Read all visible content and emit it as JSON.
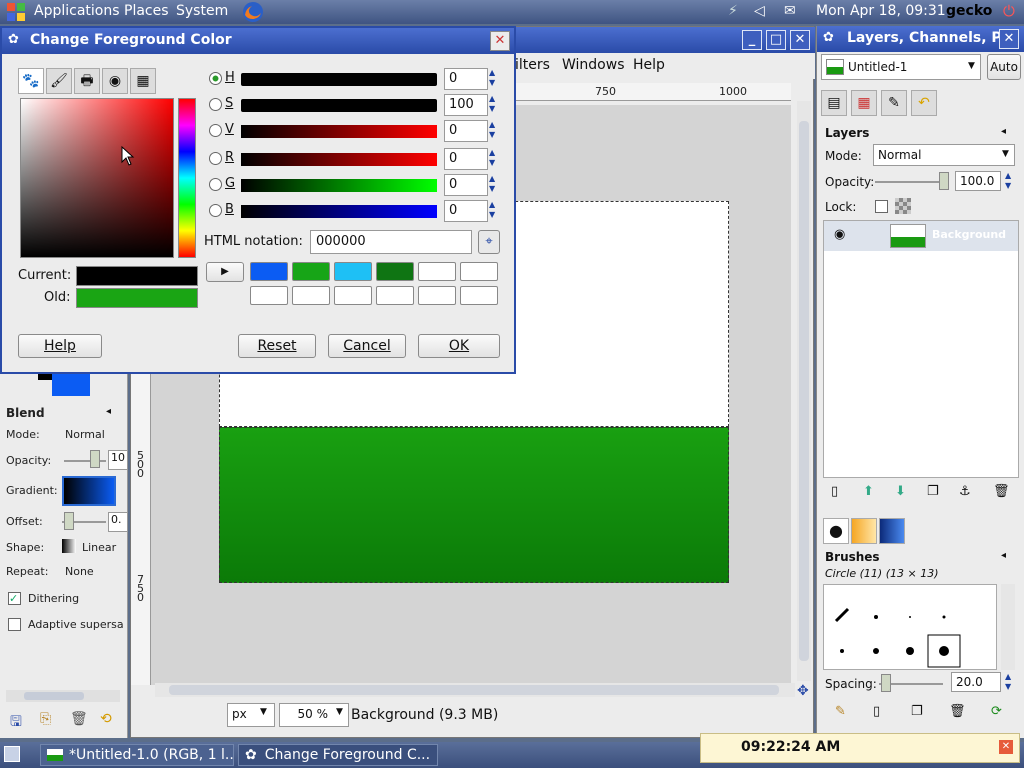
{
  "top_panel": {
    "menu": [
      "Applications",
      "Places",
      "System"
    ],
    "datetime": "Mon Apr 18, 09:31",
    "user": "gecko"
  },
  "taskbar": {
    "tasks": [
      "*Untitled-1.0 (RGB, 1 l...",
      "Change Foreground C..."
    ],
    "clock_popup": "09:22:24 AM"
  },
  "image_window": {
    "menus": [
      "ilters",
      "Windows",
      "Help"
    ],
    "ruler_ticks": [
      "750",
      "1000"
    ],
    "vruler_ticks": [
      "5\n0\n0",
      "7\n5\n0"
    ],
    "units": "px",
    "zoom": "50 %",
    "status": "Background (9.3 MB)",
    "canvas": {
      "top_color": "#ffffff",
      "bottom_color": "#119b0e"
    }
  },
  "dialog": {
    "title": "Change Foreground Color",
    "sliders": [
      {
        "label": "H",
        "value": "0"
      },
      {
        "label": "S",
        "value": "100"
      },
      {
        "label": "V",
        "value": "0"
      },
      {
        "label": "R",
        "value": "0"
      },
      {
        "label": "G",
        "value": "0"
      },
      {
        "label": "B",
        "value": "0"
      }
    ],
    "html_notation_label": "HTML notation:",
    "html_notation_value": "000000",
    "current_label": "Current:",
    "old_label": "Old:",
    "current_color": "#000000",
    "old_color": "#1aa514",
    "history_colors": [
      "#0b5cf3",
      "#17a517",
      "#1ec0f5",
      "#0f7513"
    ],
    "buttons": {
      "help": "Help",
      "reset": "Reset",
      "cancel": "Cancel",
      "ok": "OK"
    }
  },
  "toolbox": {
    "section": "Blend",
    "mode_label": "Mode:",
    "mode_value": "Normal",
    "opacity_label": "Opacity:",
    "opacity_value": "10",
    "gradient_label": "Gradient:",
    "offset_label": "Offset:",
    "offset_value": "0.",
    "shape_label": "Shape:",
    "shape_value": "Linear",
    "repeat_label": "Repeat:",
    "repeat_value": "None",
    "dithering_label": "Dithering",
    "adaptive_label": "Adaptive supersa"
  },
  "layers_dock": {
    "title": "Layers, Channels, P",
    "image_select": "Untitled-1",
    "auto_button": "Auto",
    "section": "Layers",
    "mode_label": "Mode:",
    "mode_value": "Normal",
    "opacity_label": "Opacity:",
    "opacity_value": "100.0",
    "lock_label": "Lock:",
    "layer_name": "Background",
    "brushes_section": "Brushes",
    "brush_name": "Circle (11) (13 × 13)",
    "spacing_label": "Spacing:",
    "spacing_value": "20.0"
  }
}
